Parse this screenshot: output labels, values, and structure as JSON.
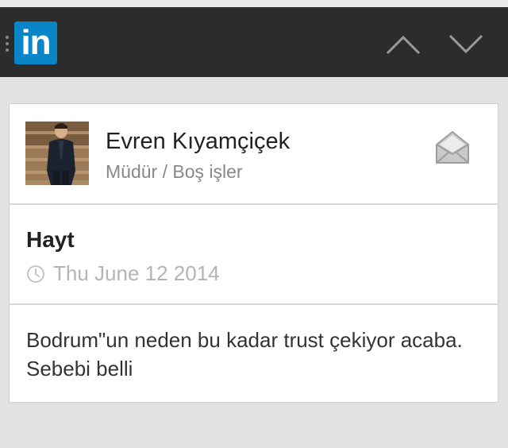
{
  "app": {
    "logo_text": "in"
  },
  "profile": {
    "name": "Evren Kıyamçiçek",
    "title": "Müdür / Boş işler"
  },
  "post": {
    "title": "Hayt",
    "date": "Thu June 12 2014",
    "body": "Bodrum\"un neden bu kadar trust çekiyor acaba. Sebebi belli"
  },
  "icons": {
    "logo": "linkedin-logo",
    "up": "chevron-up-icon",
    "down": "chevron-down-icon",
    "mail": "envelope-icon",
    "clock": "clock-icon",
    "drag": "drag-handle-icon"
  },
  "colors": {
    "navbar": "#2c2c2c",
    "brand": "#0a85c8",
    "background": "#e2e2e2",
    "card": "#ffffff",
    "muted_text": "#888888",
    "date_text": "#b4b4b4"
  }
}
